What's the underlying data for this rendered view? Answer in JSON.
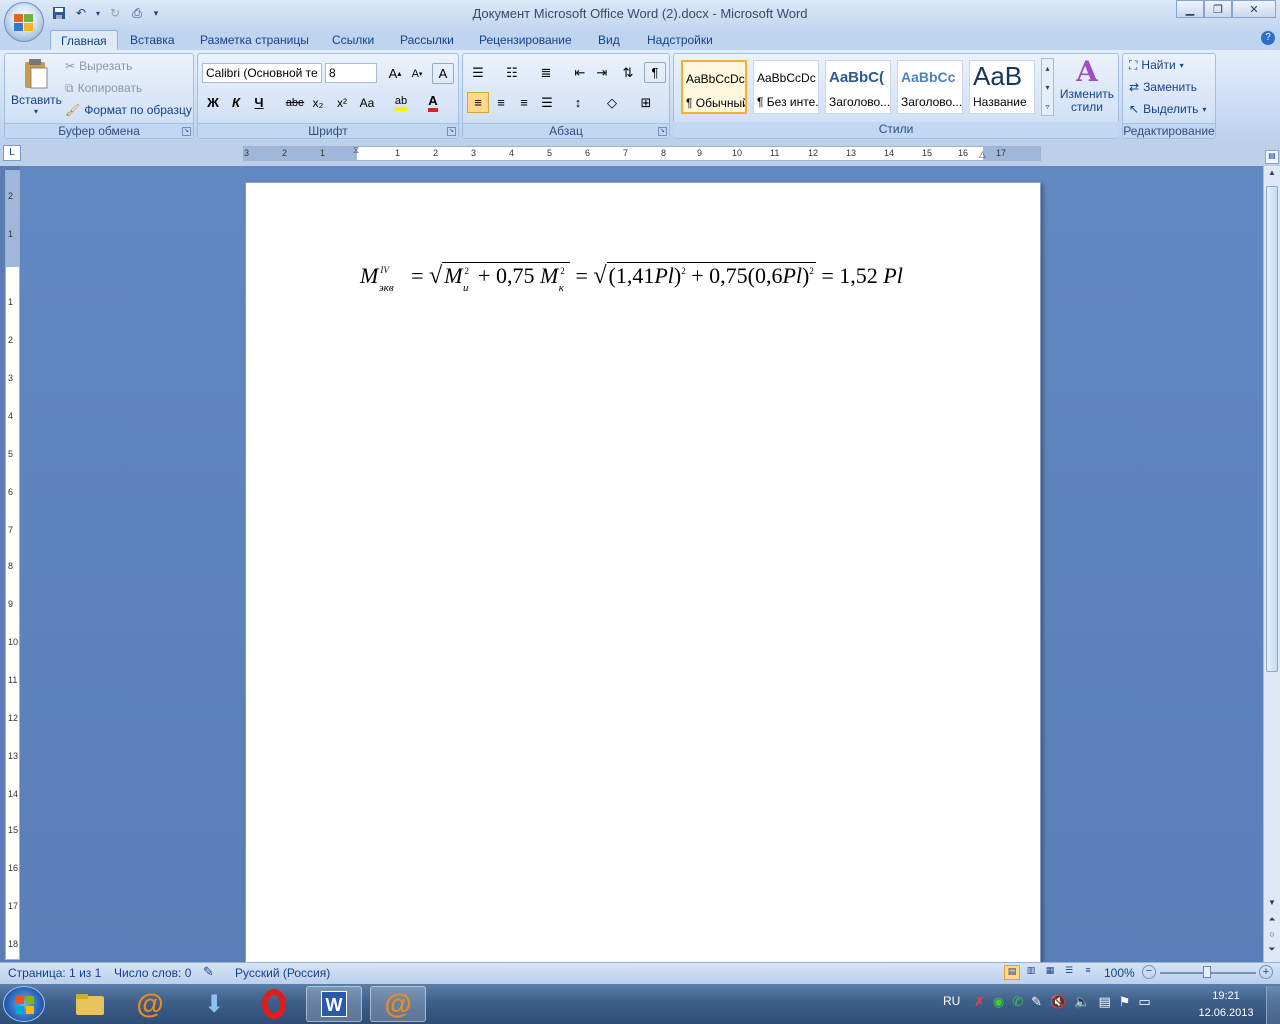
{
  "window": {
    "title": "Документ Microsoft Office Word (2).docx - Microsoft Word"
  },
  "tabs": [
    "Главная",
    "Вставка",
    "Разметка страницы",
    "Ссылки",
    "Рассылки",
    "Рецензирование",
    "Вид",
    "Надстройки"
  ],
  "clipboard": {
    "paste": "Вставить",
    "cut": "Вырезать",
    "copy": "Копировать",
    "format_painter": "Формат по образцу",
    "label": "Буфер обмена"
  },
  "font": {
    "name": "Calibri (Основной те",
    "size": "8",
    "label": "Шрифт",
    "bold": "Ж",
    "italic": "К",
    "underline": "Ч",
    "strike": "abe",
    "sub": "x₂",
    "sup": "x²",
    "case": "Aa"
  },
  "paragraph": {
    "label": "Абзац",
    "pilcrow": "¶"
  },
  "styles": {
    "label": "Стили",
    "items": [
      {
        "preview": "AaBbCcDc",
        "name": "¶ Обычный"
      },
      {
        "preview": "AaBbCcDc",
        "name": "¶ Без инте..."
      },
      {
        "preview": "AaBbC(",
        "name": "Заголово..."
      },
      {
        "preview": "AaBbCc",
        "name": "Заголово..."
      },
      {
        "preview": "AaB",
        "name": "Название"
      }
    ],
    "change": "Изменить стили"
  },
  "editing": {
    "find": "Найти",
    "replace": "Заменить",
    "select": "Выделить",
    "label": "Редактирование"
  },
  "hruler": [
    "3",
    "2",
    "1",
    "1",
    "2",
    "3",
    "4",
    "5",
    "6",
    "7",
    "8",
    "9",
    "10",
    "11",
    "12",
    "13",
    "14",
    "15",
    "16",
    "17"
  ],
  "vruler": [
    "2",
    "1",
    "1",
    "2",
    "3",
    "4",
    "5",
    "6",
    "7",
    "8",
    "9",
    "10",
    "11",
    "12",
    "13",
    "14",
    "15",
    "16",
    "17",
    "18"
  ],
  "formula": {
    "M": "M",
    "sup_iv": "IV",
    "sub_ekv": "экв",
    "eq": "=",
    "Mi": "M",
    "sub_i": "и",
    "two": "2",
    "plus": "+ 0,75",
    "Mk": "M",
    "sub_k": "к",
    "inner": "(1,41",
    "Pl": "Pl",
    ")": ")",
    "plus2": "+ 0,75(0,6",
    "result": "= 1,52"
  },
  "status": {
    "page": "Страница: 1 из 1",
    "words": "Число слов: 0",
    "lang": "Русский (Россия)",
    "zoom": "100%"
  },
  "tray": {
    "lang": "RU",
    "time": "19:21",
    "date": "12.06.2013"
  }
}
